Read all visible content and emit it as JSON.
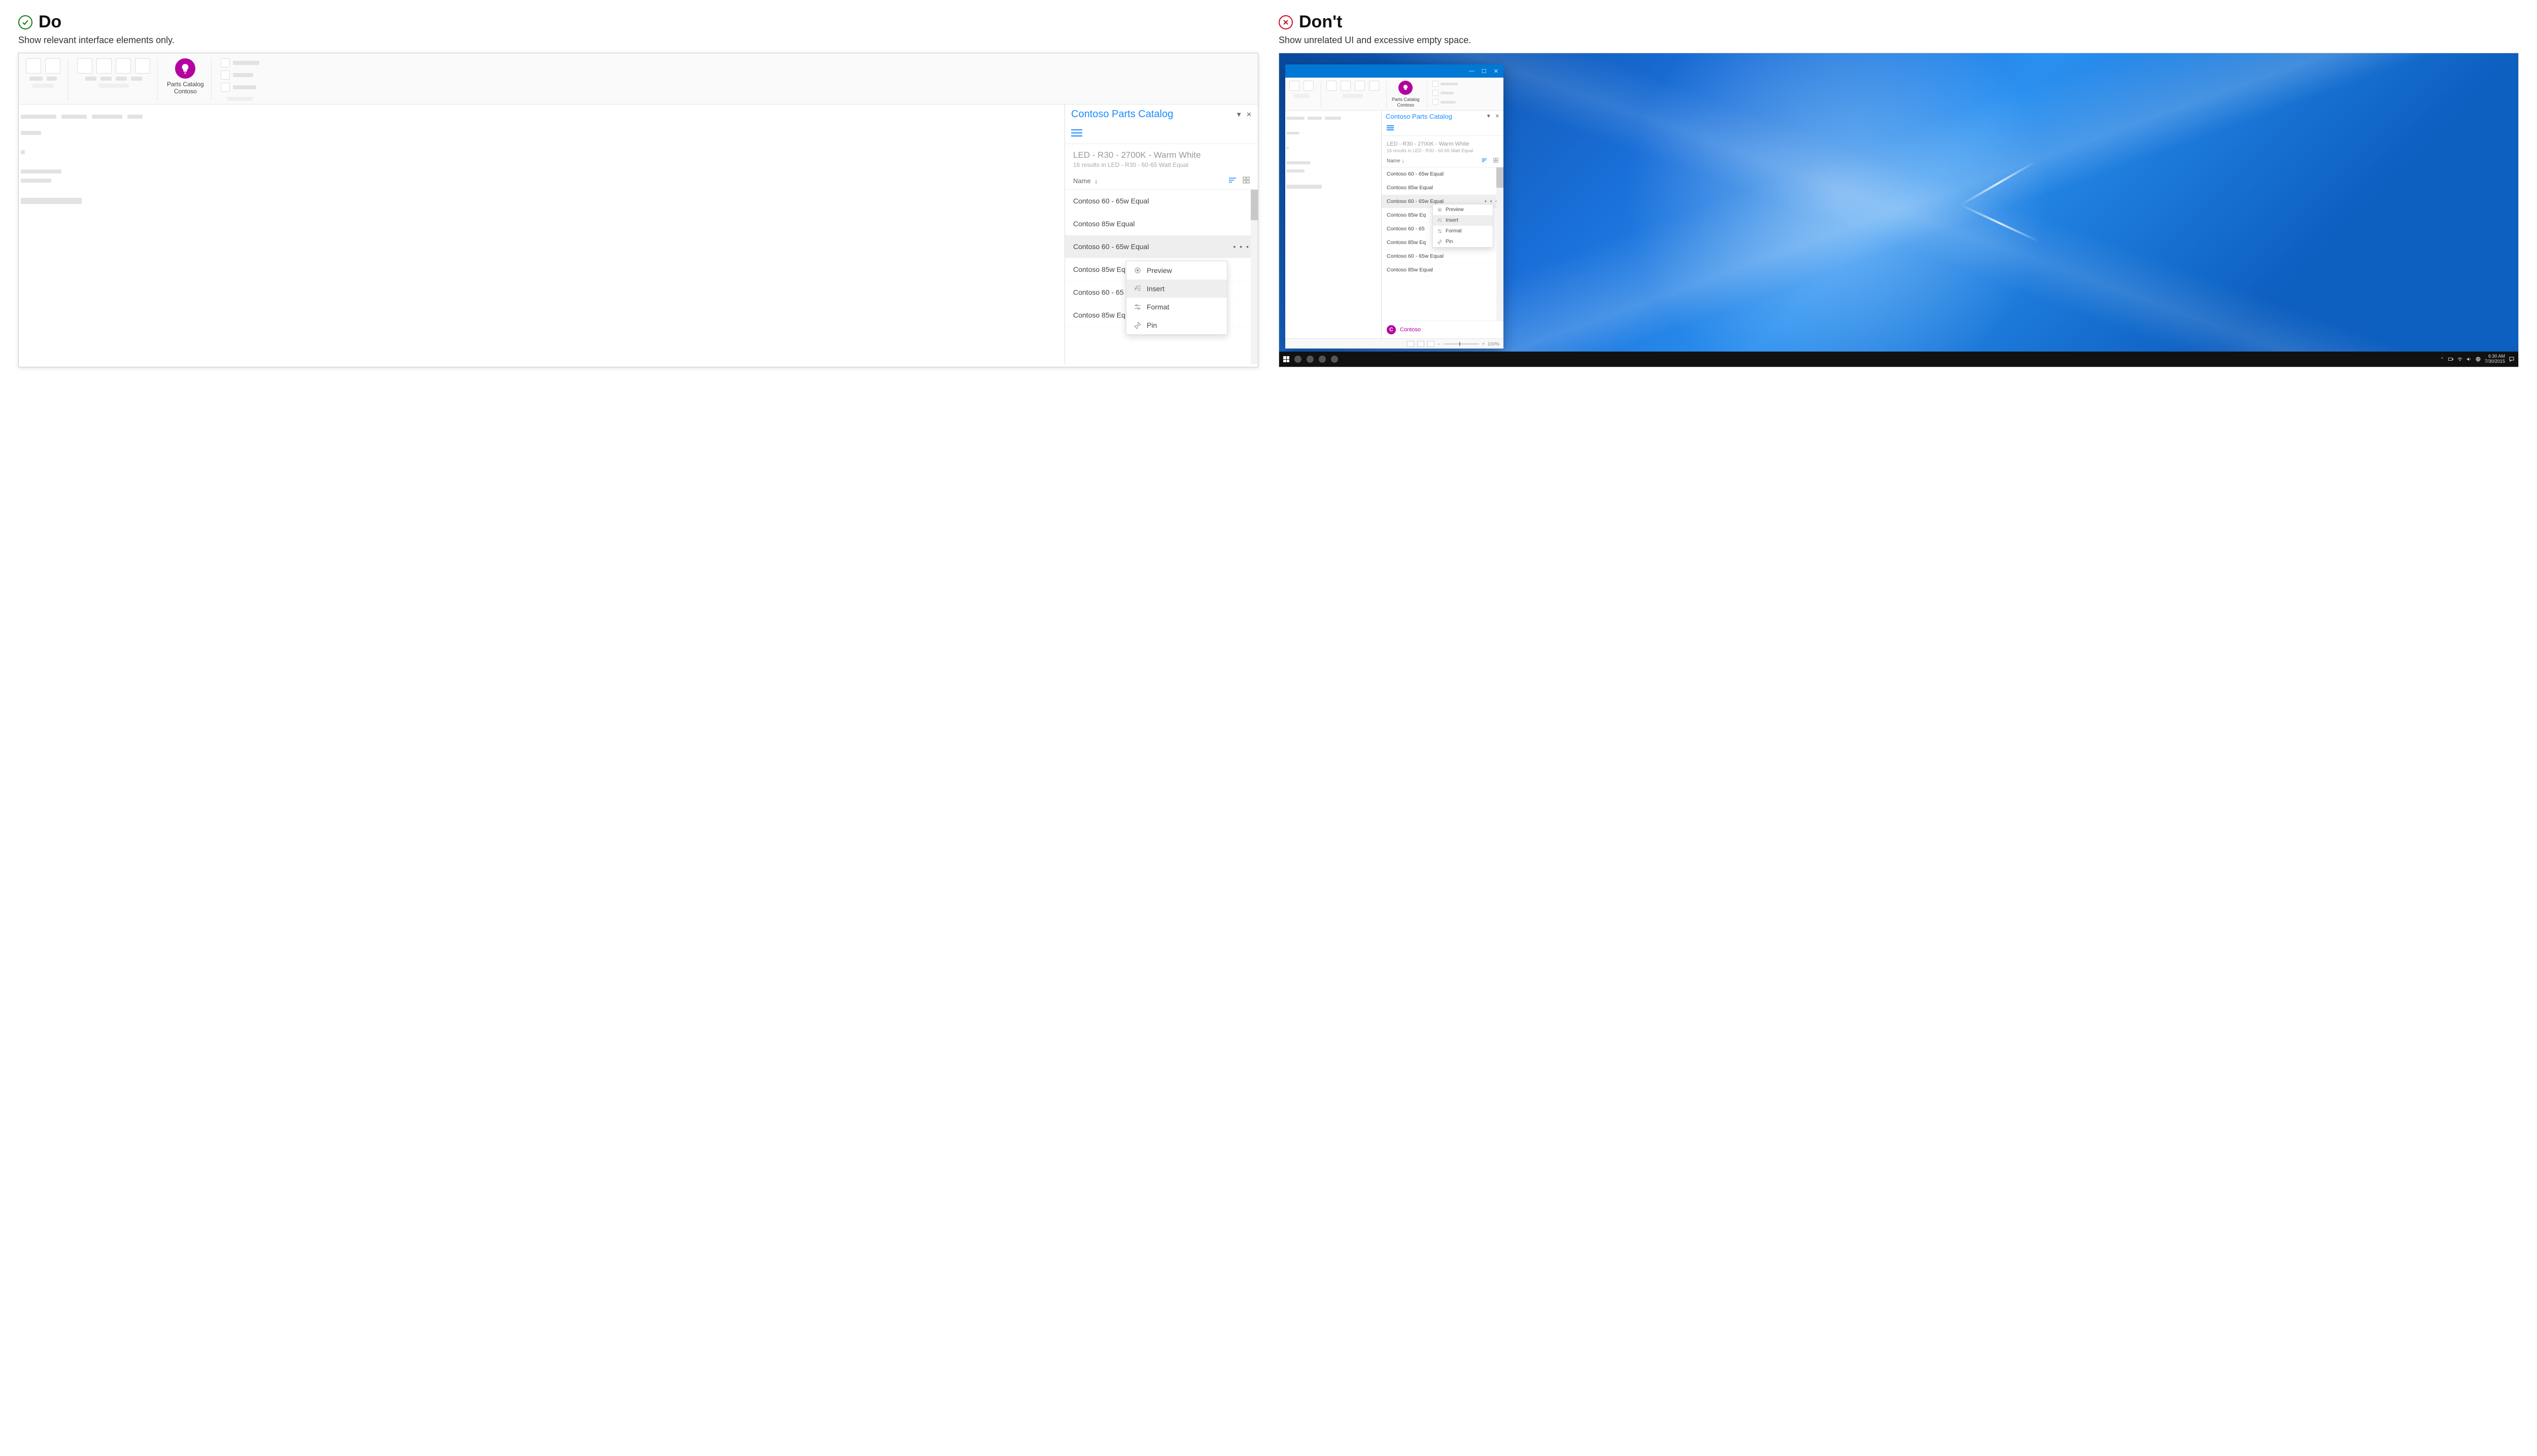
{
  "do": {
    "title": "Do",
    "subtitle": "Show relevant interface elements only."
  },
  "dont": {
    "title": "Don't",
    "subtitle": "Show unrelated UI and excessive empty space."
  },
  "ribbon_button": {
    "line1": "Parts Catalog",
    "line2": "Contoso"
  },
  "pane": {
    "title": "Contoso Parts Catalog",
    "heading": "LED - R30 - 2700K - Warm White",
    "subheading": "16 results in LED - R30 - 60-65 Watt Equal",
    "column_label": "Name",
    "items": [
      "Contoso 60 - 65w Equal",
      "Contoso 85w Equal",
      "Contoso 60 - 65w Equal",
      "Contoso 85w Eq",
      "Contoso 60 - 65",
      "Contoso 85w Eq"
    ],
    "selected_index": 2,
    "brand_name": "Contoso",
    "brand_initial": "C"
  },
  "dont_pane_items": [
    "Contoso 60 - 65w Equal",
    "Contoso 85w Equal",
    "Contoso 60 - 65w Equal",
    "Contoso 85w Eq",
    "Contoso 60 - 65",
    "Contoso 85w Eq",
    "Contoso 60 - 65w Equal",
    "Contoso 85w Equal"
  ],
  "menu": {
    "items": [
      "Preview",
      "Insert",
      "Format",
      "Pin"
    ],
    "highlighted_index": 1
  },
  "statusbar": {
    "zoom": "100%"
  },
  "taskbar": {
    "time": "6:30 AM",
    "date": "7/30/2015"
  }
}
